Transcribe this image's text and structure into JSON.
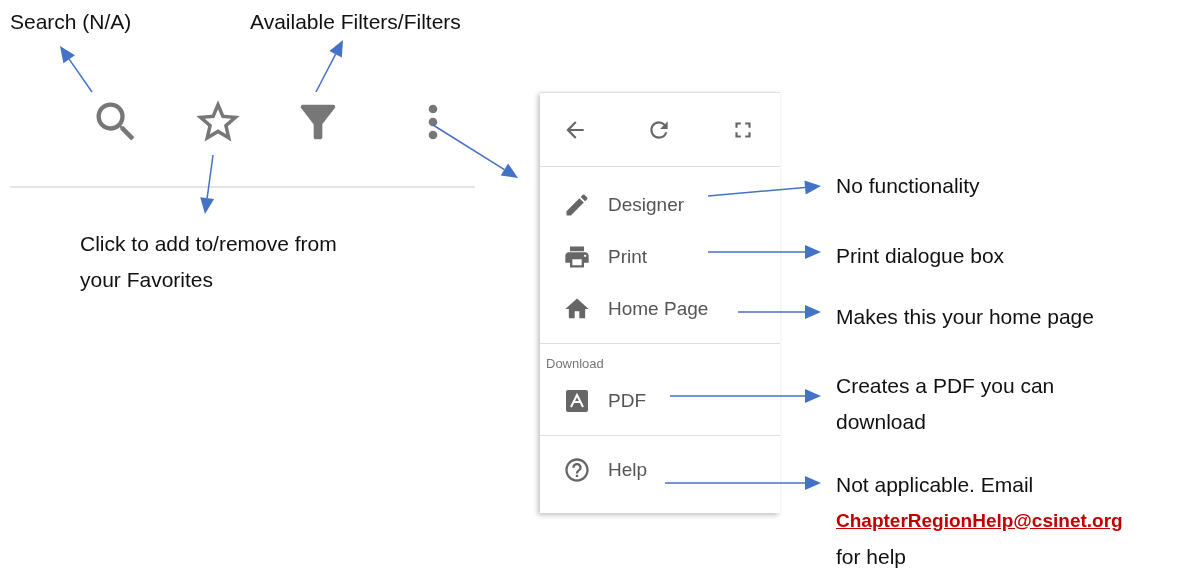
{
  "top_callouts": [
    {
      "text": "Search (N/A)"
    },
    {
      "text": "Available Filters/Filters"
    }
  ],
  "toolbar": [
    {
      "kind": "search"
    },
    {
      "kind": "star"
    },
    {
      "kind": "filter"
    },
    {
      "kind": "more"
    }
  ],
  "favorites_callout": {
    "text": "Click to add to/remove from your Favorites"
  },
  "menu": {
    "top_actions": [
      {
        "kind": "back"
      },
      {
        "kind": "refresh"
      },
      {
        "kind": "fullscreen"
      }
    ],
    "groups": [
      {
        "items": [
          {
            "label": "Designer",
            "kind": "pencil",
            "note": "No functionality"
          },
          {
            "label": "Print",
            "kind": "printer",
            "note": "Print dialogue box"
          },
          {
            "label": "Home Page",
            "kind": "home",
            "note": "Makes this your home page"
          }
        ]
      },
      {
        "heading": "Download",
        "items": [
          {
            "label": "PDF",
            "kind": "pdf",
            "note": "Creates a PDF you can download"
          }
        ]
      },
      {
        "items": [
          {
            "label": "Help",
            "kind": "help",
            "note": "Not applicable. Email",
            "note_link": "ChapterRegionHelp@csinet.org",
            "note_after": "for help"
          }
        ]
      }
    ]
  }
}
